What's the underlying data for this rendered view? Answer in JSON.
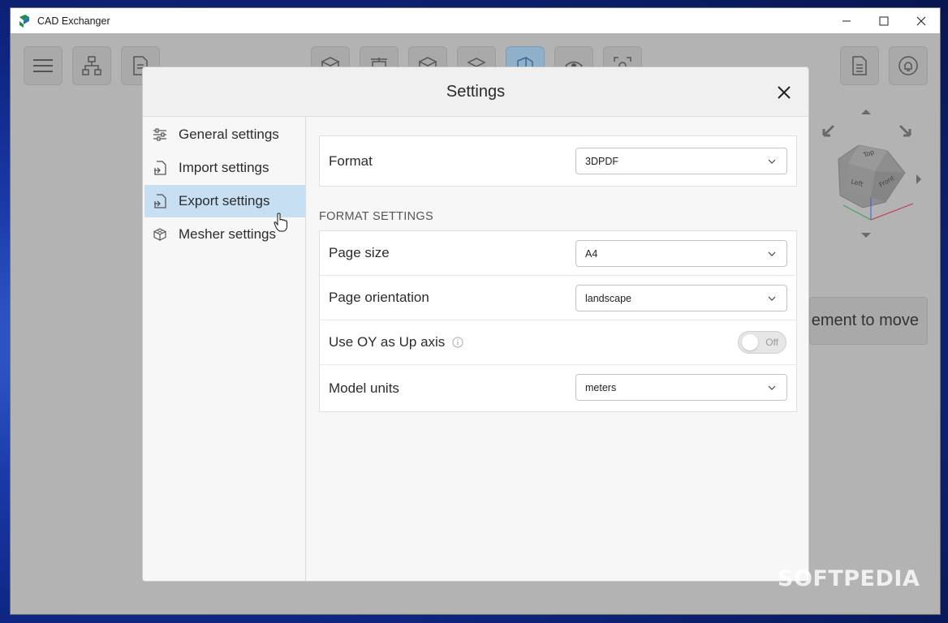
{
  "window": {
    "title": "CAD Exchanger"
  },
  "background": {
    "partial_text": "ement to move",
    "watermark": "SOFTPEDIA"
  },
  "toolbar": {
    "left_buttons": [
      "menu-icon",
      "structure-tree-icon",
      "document-convert-icon"
    ],
    "center_buttons": [
      "cube-icon",
      "dimensions-icon",
      "cube-shaded-icon",
      "layers-icon",
      "section-view-icon",
      "eye-scan-icon",
      "focus-scan-icon"
    ],
    "active_button": "section-view-icon",
    "right_buttons": [
      "document-icon",
      "notification-icon"
    ]
  },
  "viewcube": {
    "faces": [
      "Top",
      "Front",
      "Left"
    ]
  },
  "dialog": {
    "title": "Settings",
    "sidebar": [
      {
        "label": "General settings",
        "icon": "sliders-icon"
      },
      {
        "label": "Import settings",
        "icon": "import-file-icon"
      },
      {
        "label": "Export settings",
        "icon": "export-file-icon",
        "selected": true
      },
      {
        "label": "Mesher settings",
        "icon": "mesh-cube-icon"
      }
    ],
    "format": {
      "label": "Format",
      "value": "3DPDF"
    },
    "section_title": "FORMAT SETTINGS",
    "page_size": {
      "label": "Page size",
      "value": "A4"
    },
    "page_orientation": {
      "label": "Page orientation",
      "value": "landscape"
    },
    "up_axis": {
      "label": "Use OY as Up axis",
      "toggle": "Off",
      "checked": false
    },
    "model_units": {
      "label": "Model units",
      "value": "meters"
    }
  },
  "colors": {
    "selected_nav": "#c6dff2",
    "active_tool": "#8fb0c9",
    "dialog_bg": "#f7f7f7"
  }
}
